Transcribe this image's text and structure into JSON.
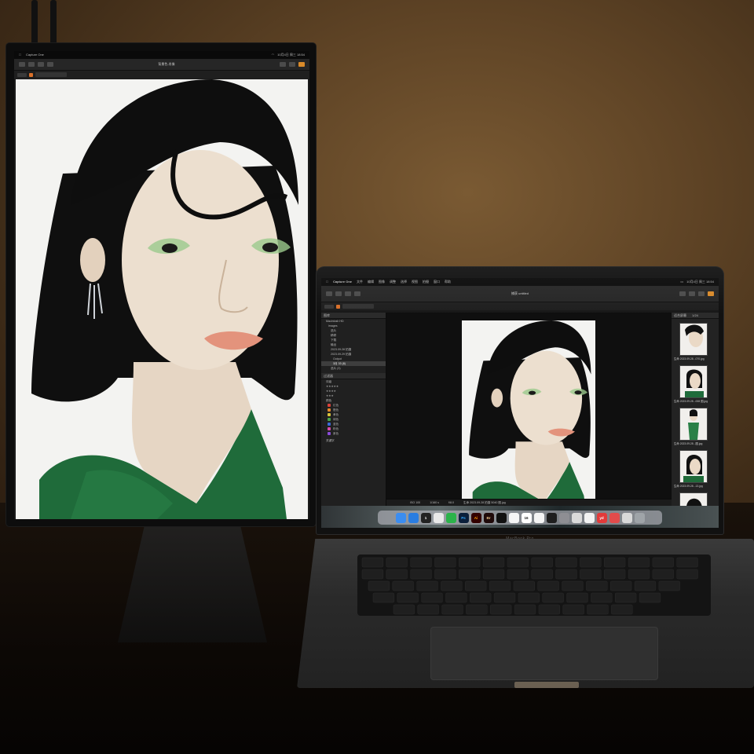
{
  "monitor_app": {
    "title": "背景色-肖像",
    "menu": [
      "Capture One"
    ],
    "status_right": "10月4日 周三 18:54"
  },
  "laptop_app": {
    "app_name": "Capture One",
    "menu": [
      "文件",
      "编辑",
      "图像",
      "调整",
      "选择",
      "视图",
      "拍摄",
      "窗口",
      "帮助"
    ],
    "title": "捕获 untitled",
    "clock": "10月4日 周三 18:54",
    "left_panel": {
      "library_header": "图库",
      "tree": [
        "Macintosh HD",
        "images",
        "选片",
        "精修",
        "下载",
        "输出",
        "2023.09.28 拍摄",
        "2023.09.29 拍摄",
        "Output",
        "选片 (3)"
      ],
      "selected_item": "3月 33 (8)",
      "filters_header": "过滤器",
      "rating_header": "评级",
      "color_header": "颜色",
      "colors": [
        {
          "name": "红色",
          "hex": "#d9413a"
        },
        {
          "name": "橙色",
          "hex": "#e38a2c"
        },
        {
          "name": "黄色",
          "hex": "#d9c23a"
        },
        {
          "name": "绿色",
          "hex": "#49a44a"
        },
        {
          "name": "蓝色",
          "hex": "#3a6bd9"
        },
        {
          "name": "粉色",
          "hex": "#d94aa8"
        },
        {
          "name": "紫色",
          "hex": "#8a4ad9"
        }
      ],
      "footer": "关键字"
    },
    "filmstrip": {
      "count": "1/24",
      "header": "适合屏幕",
      "items": [
        {
          "label": "生命 2023.09.28...070.jpg"
        },
        {
          "label": "生命 2023.09.28...008 图.jpg"
        },
        {
          "label": "生命 2023.09.28...图.jpg"
        },
        {
          "label": "生命 2023.09.28...13.jpg"
        },
        {
          "label": "生命 2023.09.28...16.jpg"
        }
      ]
    },
    "status_bar": {
      "iso": "ISO 100",
      "shutter": "1/160 s",
      "aperture": "f/8.0",
      "filename": "生命 2023.09.28 拍摄 5040 图.jpg"
    },
    "dock": [
      {
        "name": "finder-icon",
        "label": "",
        "color": "#3b8df0"
      },
      {
        "name": "safari-icon",
        "label": "",
        "color": "#2a7de1"
      },
      {
        "name": "one-icon",
        "label": "1",
        "color": "#222222"
      },
      {
        "name": "grid-icon",
        "label": "",
        "color": "#e9e9e9"
      },
      {
        "name": "wechat-icon",
        "label": "",
        "color": "#2bb34a"
      },
      {
        "name": "photoshop-icon",
        "label": "Ps",
        "color": "#0b1f3b"
      },
      {
        "name": "illustrator-icon",
        "label": "Ai",
        "color": "#330000"
      },
      {
        "name": "bridge-icon",
        "label": "Br",
        "color": "#1f0a0a"
      },
      {
        "name": "capcut-icon",
        "label": "",
        "color": "#111111"
      },
      {
        "name": "notes-icon",
        "label": "",
        "color": "#f5f5f5"
      },
      {
        "name": "calendar-icon",
        "label": "16",
        "color": "#ffffff"
      },
      {
        "name": "photos-icon",
        "label": "",
        "color": "#f4f4f4"
      },
      {
        "name": "terminal-icon",
        "label": "",
        "color": "#1e1e1e"
      },
      {
        "name": "settings-icon",
        "label": "",
        "color": "#8e8e93"
      },
      {
        "name": "link-icon",
        "label": "",
        "color": "#dadada"
      },
      {
        "name": "bird-icon",
        "label": "",
        "color": "#f2f2f2"
      },
      {
        "name": "yd-icon",
        "label": "yd",
        "color": "#e23a3a"
      },
      {
        "name": "circle-icon",
        "label": "",
        "color": "#e24b4b"
      },
      {
        "name": "doc-icon",
        "label": "",
        "color": "#d9d9d9"
      },
      {
        "name": "trash-icon",
        "label": "",
        "color": "#9fa4a8"
      }
    ],
    "brand": "MacBook Pro"
  },
  "colors": {
    "wall": "#5e4325",
    "dress": "#1f6b3a",
    "hair": "#0e0e0e",
    "skin": "#eadbca",
    "accent": "#d98a2a"
  }
}
